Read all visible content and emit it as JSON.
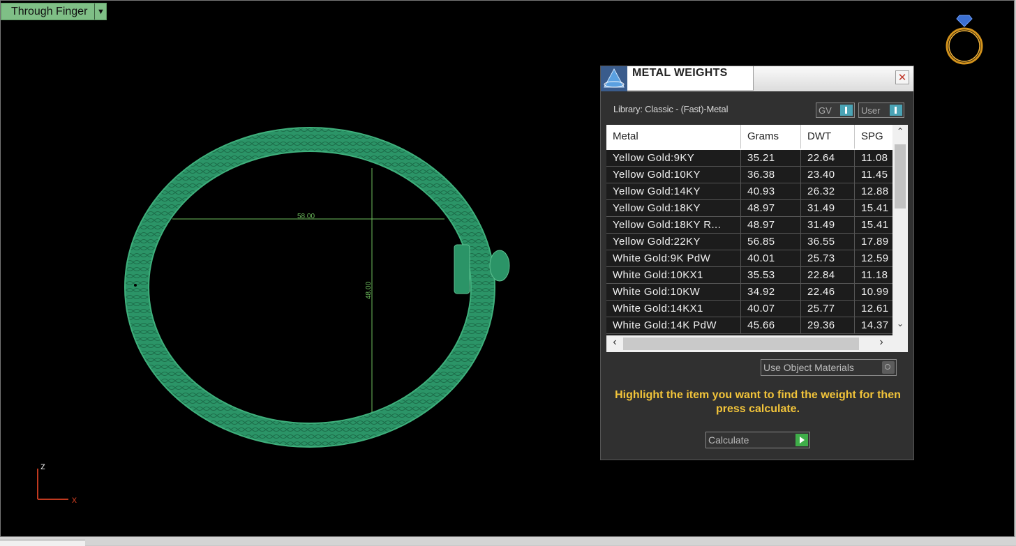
{
  "viewport": {
    "view_name": "Through Finger",
    "view_dropdown_icon": "caret-down-icon",
    "axis_labels": {
      "z": "z",
      "x": "x"
    },
    "dimension_horizontal": "58.00",
    "dimension_vertical": "48.00",
    "ring_color": "#2e9e6e",
    "dimension_color": "#7cd36a"
  },
  "dialog": {
    "title": "METAL WEIGHTS",
    "logo_icon": "gemvision-logo-icon",
    "close_icon": "close-icon",
    "library_label": "Library: Classic - (Fast)-Metal",
    "toggle_gv": "GV",
    "toggle_user": "User",
    "table": {
      "columns": [
        "Metal",
        "Grams",
        "DWT",
        "SPG"
      ],
      "rows": [
        [
          "Yellow Gold:9KY",
          "35.21",
          "22.64",
          "11.08"
        ],
        [
          "Yellow Gold:10KY",
          "36.38",
          "23.40",
          "11.45"
        ],
        [
          "Yellow Gold:14KY",
          "40.93",
          "26.32",
          "12.88"
        ],
        [
          "Yellow Gold:18KY",
          "48.97",
          "31.49",
          "15.41"
        ],
        [
          "Yellow Gold:18KY R...",
          "48.97",
          "31.49",
          "15.41"
        ],
        [
          "Yellow Gold:22KY",
          "56.85",
          "36.55",
          "17.89"
        ],
        [
          "White Gold:9K PdW",
          "40.01",
          "25.73",
          "12.59"
        ],
        [
          "White Gold:10KX1",
          "35.53",
          "22.84",
          "11.18"
        ],
        [
          "White Gold:10KW",
          "34.92",
          "22.46",
          "10.99"
        ],
        [
          "White Gold:14KX1",
          "40.07",
          "25.77",
          "12.61"
        ],
        [
          "White Gold:14K PdW",
          "45.66",
          "29.36",
          "14.37"
        ]
      ]
    },
    "use_object_materials": "Use Object Materials",
    "hint": "Highlight the item you want to find the weight for then press calculate.",
    "calculate_label": "Calculate",
    "accent_color": "#f2c43a"
  }
}
